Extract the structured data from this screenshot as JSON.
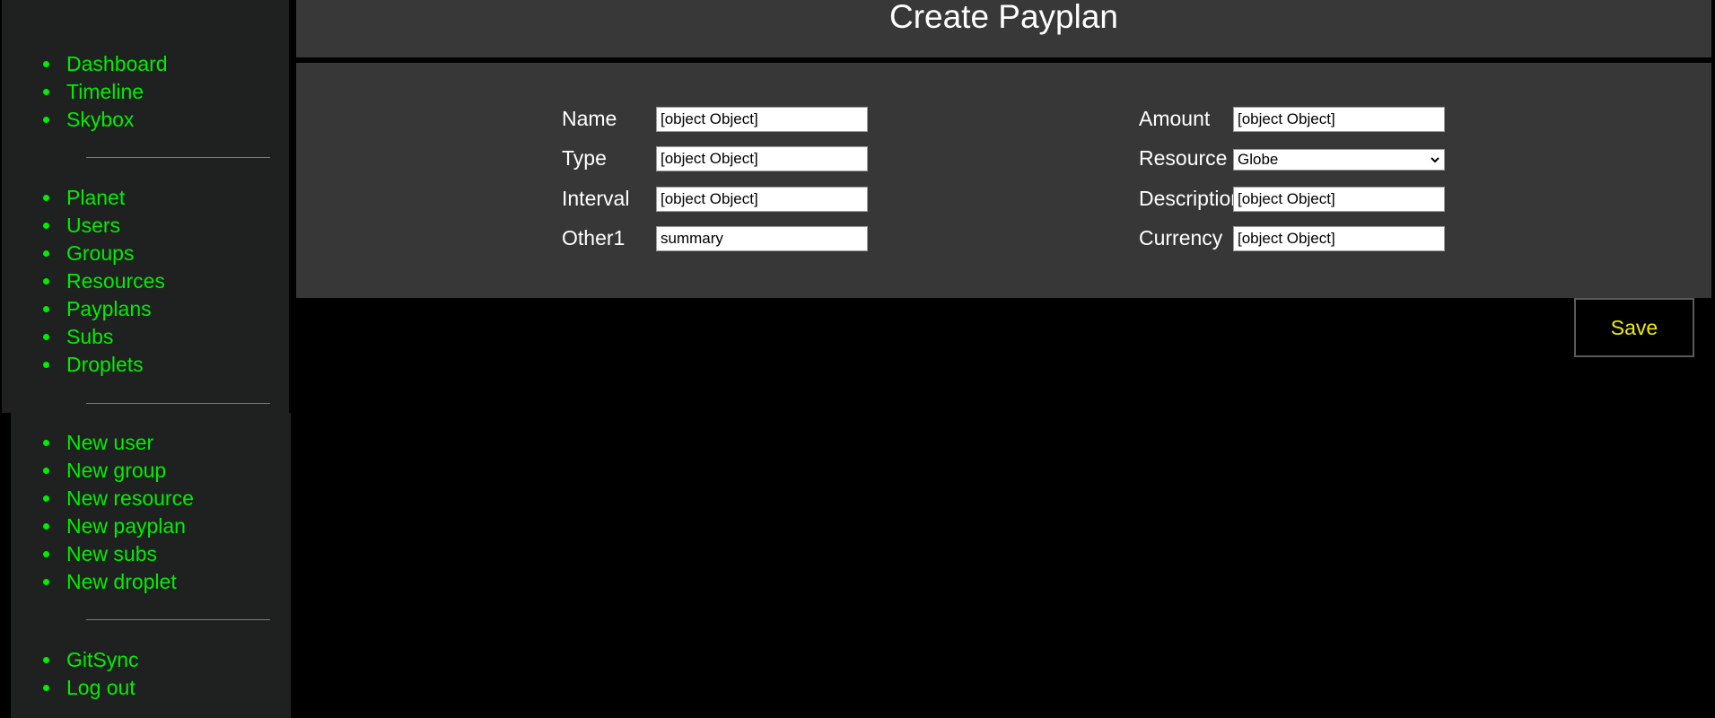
{
  "colors": {
    "accent_green": "#00ee00",
    "sidebar_bg": "#1f2020",
    "panel_bg": "#373737",
    "save_text": "#eeee00"
  },
  "sidebar": {
    "group1": [
      "Dashboard",
      "Timeline",
      "Skybox"
    ],
    "group2": [
      "Planet",
      "Users",
      "Groups",
      "Resources",
      "Payplans",
      "Subs",
      "Droplets"
    ],
    "group3": [
      "New user",
      "New group",
      "New resource",
      "New payplan",
      "New subs",
      "New droplet"
    ],
    "group4": [
      "GitSync",
      "Log out"
    ]
  },
  "header": {
    "title": "Create Payplan"
  },
  "form": {
    "name": {
      "label": "Name",
      "value": "[object Object]"
    },
    "type": {
      "label": "Type",
      "value": "[object Object]"
    },
    "interval": {
      "label": "Interval",
      "value": "[object Object]"
    },
    "other1": {
      "label": "Other1",
      "value": "summary"
    },
    "amount": {
      "label": "Amount",
      "value": "[object Object]"
    },
    "resource": {
      "label": "Resource",
      "value": "Globe",
      "icon": "chevron-down-icon"
    },
    "description": {
      "label": "Description",
      "value": "[object Object]"
    },
    "currency": {
      "label": "Currency",
      "value": "[object Object]"
    }
  },
  "actions": {
    "save_label": "Save"
  }
}
